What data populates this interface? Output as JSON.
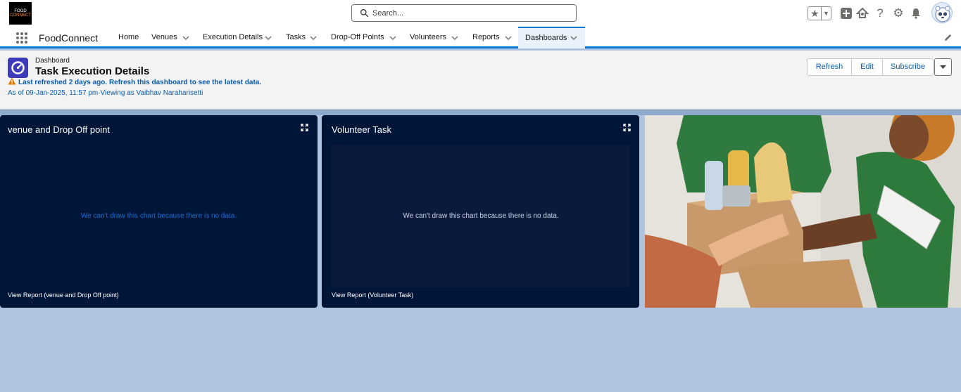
{
  "global_header": {
    "logo": {
      "line1": "FOOD",
      "line2": "CONNECT"
    },
    "search": {
      "placeholder": "Search..."
    },
    "icons": [
      "star-icon",
      "chevron-down-icon",
      "add-icon",
      "trailhead-icon",
      "help-icon",
      "gear-icon",
      "bell-icon",
      "avatar"
    ]
  },
  "app_nav": {
    "app_name": "FoodConnect",
    "items": [
      {
        "label": "Home",
        "has_menu": false
      },
      {
        "label": "Venues",
        "has_menu": true
      },
      {
        "label": "Execution Details",
        "has_menu": true
      },
      {
        "label": "Tasks",
        "has_menu": true
      },
      {
        "label": "Drop-Off Points",
        "has_menu": true
      },
      {
        "label": "Volunteers",
        "has_menu": true
      },
      {
        "label": "Reports",
        "has_menu": true
      },
      {
        "label": "Dashboards",
        "has_menu": true,
        "active": true
      }
    ]
  },
  "dashboard": {
    "object_label": "Dashboard",
    "title": "Task Execution Details",
    "refresh_note": "Last refreshed 2 days ago. Refresh this dashboard to see the latest data.",
    "as_of": "As of 09-Jan-2025, 11:57 pm·Viewing as Vaibhav Naraharisetti",
    "buttons": {
      "refresh": "Refresh",
      "edit": "Edit",
      "subscribe": "Subscribe"
    }
  },
  "widgets": [
    {
      "title": "venue and Drop Off point",
      "nodata": "We can't draw this chart because there is no data.",
      "view_report": "View Report (venue and Drop Off point)"
    },
    {
      "title": "Volunteer Task",
      "nodata": "We can't draw this chart because there is no data.",
      "view_report": "View Report (Volunteer Task)"
    }
  ],
  "colors": {
    "brand": "#0176d3",
    "widget_bg": "#001639",
    "canvas_bg": "#b0c4df",
    "link": "#0b5cab",
    "dashboard_icon": "#3c3bbc",
    "warning": "#dd7a01"
  }
}
